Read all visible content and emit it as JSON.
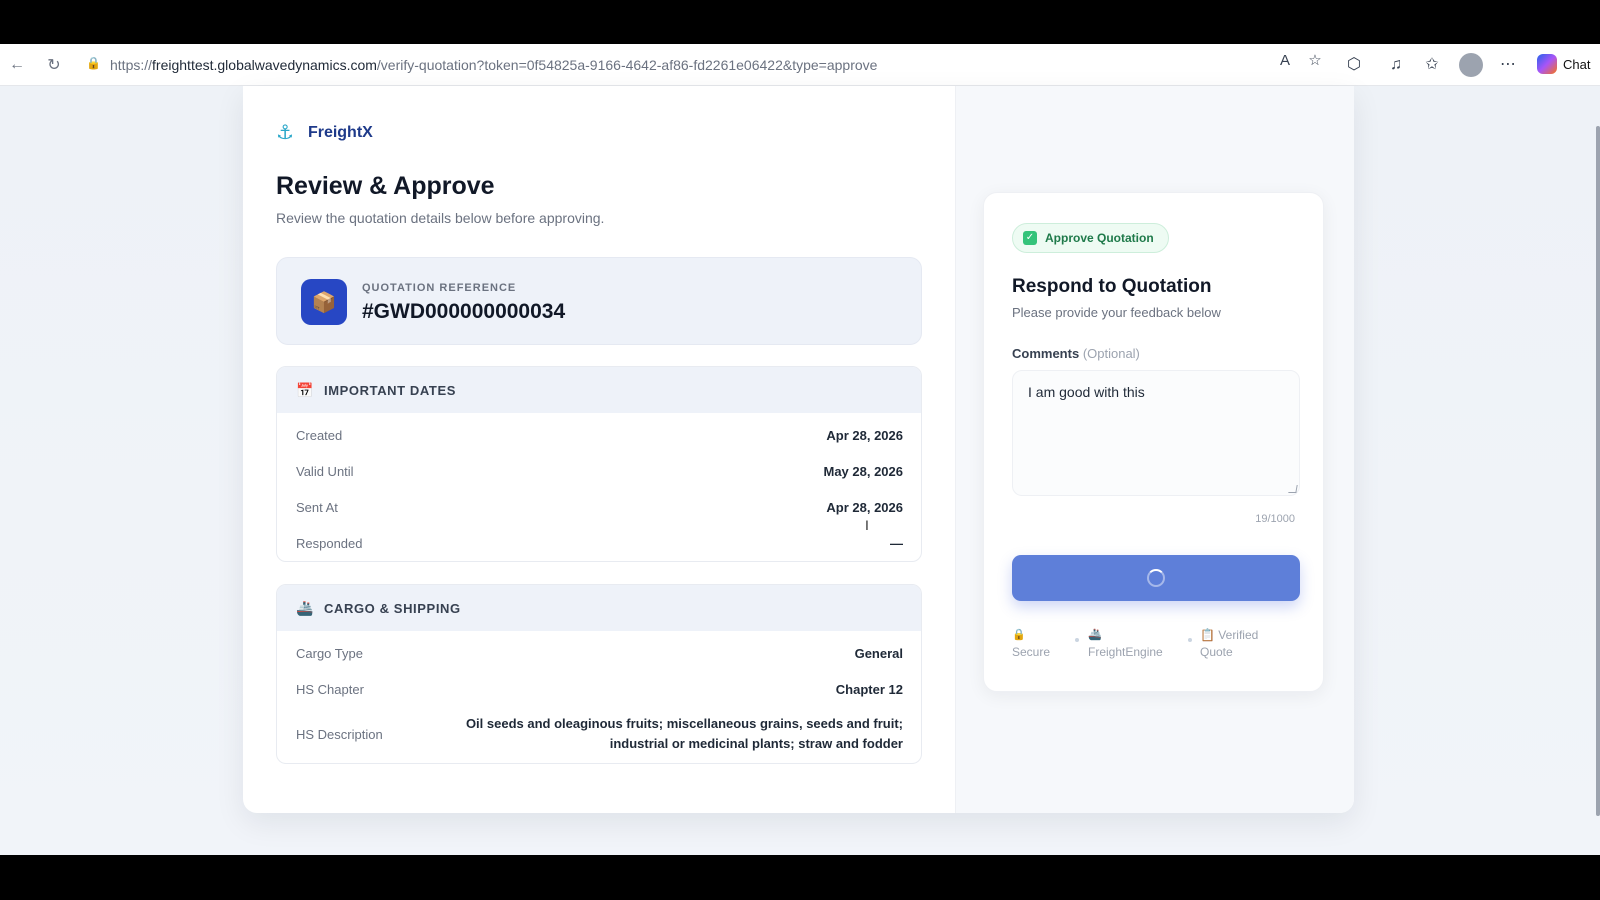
{
  "browser": {
    "url_prefix": "https://",
    "url_host": "freighttest.globalwavedynamics.com",
    "url_path": "/verify-quotation?token=0f54825a-9166-4642-af86-fd2261e06422&type=approve",
    "chat_label": "Chat"
  },
  "brand": {
    "name": "FreightX",
    "icon": "anchor-icon"
  },
  "page": {
    "title": "Review & Approve",
    "subtitle": "Review the quotation details below before approving."
  },
  "quotation": {
    "label": "QUOTATION REFERENCE",
    "reference": "#GWD000000000034",
    "icon": "package-icon"
  },
  "dates": {
    "title": "IMPORTANT DATES",
    "icon": "calendar-icon",
    "rows": [
      {
        "label": "Created",
        "value": "Apr 28, 2026"
      },
      {
        "label": "Valid Until",
        "value": "May 28, 2026"
      },
      {
        "label": "Sent At",
        "value": "Apr 28, 2026"
      },
      {
        "label": "Responded",
        "value": "—"
      }
    ]
  },
  "cargo": {
    "title": "CARGO & SHIPPING",
    "icon": "ship-icon",
    "rows": [
      {
        "label": "Cargo Type",
        "value": "General"
      },
      {
        "label": "HS Chapter",
        "value": "Chapter 12"
      },
      {
        "label": "HS Description",
        "value": "Oil seeds and oleaginous fruits; miscellaneous grains, seeds and fruit; industrial or medicinal plants; straw and fodder"
      }
    ]
  },
  "response": {
    "pill": "Approve Quotation",
    "title": "Respond to Quotation",
    "subtitle": "Please provide your feedback below",
    "comments_label": "Comments",
    "comments_optional": "(Optional)",
    "comments_value": "I am good with this",
    "counter": "19/1000",
    "badges": [
      {
        "icon": "lock-icon",
        "label": "Secure"
      },
      {
        "icon": "ship-icon",
        "label": "FreightEngine"
      },
      {
        "icon": "clipboard-icon",
        "label": "Verified Quote"
      }
    ]
  },
  "colors": {
    "brand": "#1e3a8a",
    "accent": "#5e7fd9",
    "success": "#34c37a"
  }
}
